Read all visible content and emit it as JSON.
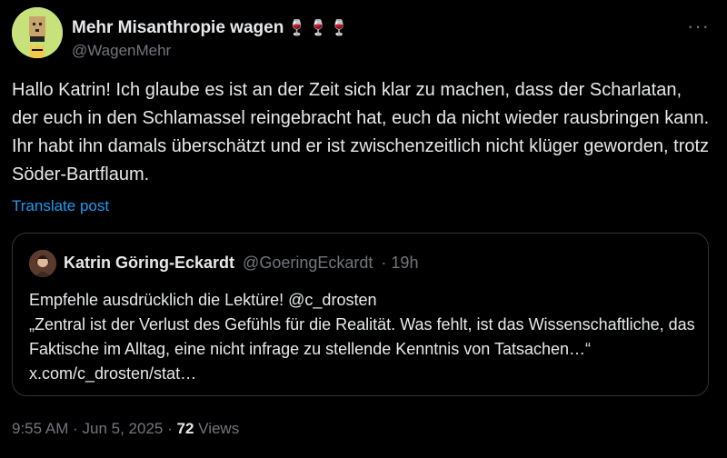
{
  "author": {
    "name": "Mehr Misanthropie wagen",
    "name_emoji": "🍷🍷🍷",
    "handle": "@WagenMehr"
  },
  "post": {
    "text": "Hallo Katrin! Ich glaube es ist an der Zeit sich klar zu machen, dass der Scharlatan, der euch in den Schlamassel reingebracht hat, euch da nicht wieder rausbringen kann. Ihr habt ihn damals überschätzt und er ist zwischenzeitlich nicht klüger geworden, trotz Söder-Bartflaum.",
    "translate_label": "Translate post"
  },
  "quoted": {
    "name": "Katrin Göring-Eckardt",
    "handle": "@GoeringEckardt",
    "separator": "·",
    "time": "19h",
    "line1": "Empfehle ausdrücklich die Lektüre! @c_drosten",
    "line2": "„Zentral ist der Verlust des Gefühls für die Realität. Was fehlt, ist das Wissenschaftliche, das Faktische im Alltag, eine nicht infrage zu stellende Kenntnis von Tatsachen…“ x.com/c_drosten/stat…"
  },
  "meta": {
    "time": "9:55 AM",
    "sep1": "·",
    "date": "Jun 5, 2025",
    "sep2": "·",
    "views_count": "72",
    "views_label": "Views"
  },
  "icons": {
    "more": "more-icon"
  }
}
